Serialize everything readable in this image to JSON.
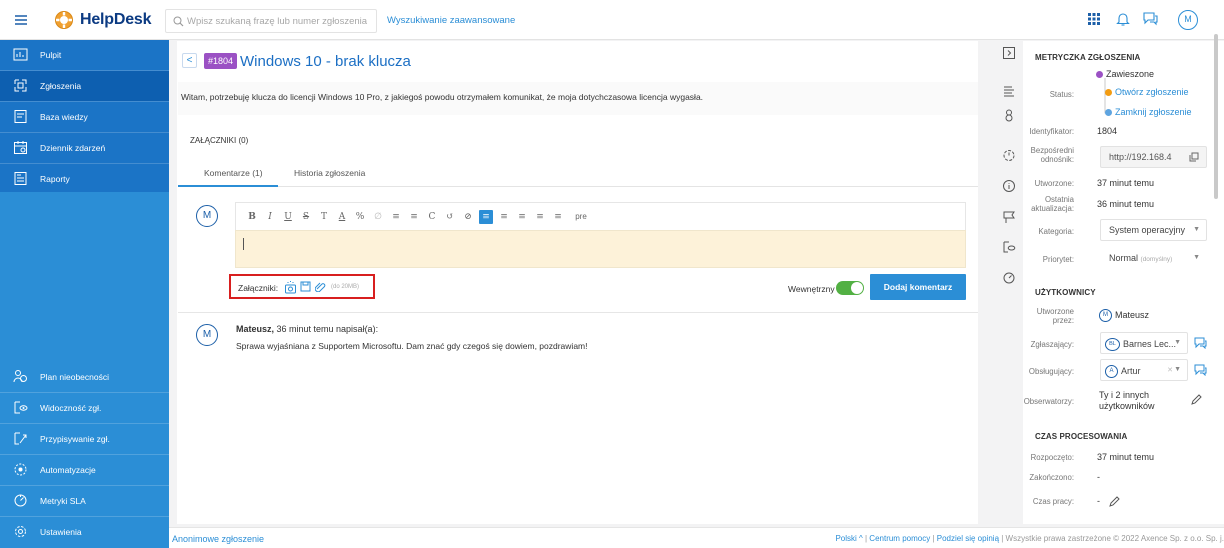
{
  "topbar": {
    "logo": "HelpDesk",
    "search_placeholder": "Wpisz szukaną frazę lub numer zgłoszenia",
    "advanced_search": "Wyszukiwanie zaawansowane",
    "user_initial": "M"
  },
  "sidebar": {
    "items_top": [
      {
        "label": "Pulpit",
        "icon": "dashboard-icon"
      },
      {
        "label": "Zgłoszenia",
        "icon": "tickets-icon",
        "active": true
      },
      {
        "label": "Baza wiedzy",
        "icon": "book-icon"
      },
      {
        "label": "Dziennik zdarzeń",
        "icon": "calendar-icon"
      },
      {
        "label": "Raporty",
        "icon": "report-icon"
      }
    ],
    "items_bottom": [
      {
        "label": "Plan nieobecności",
        "icon": "people-icon"
      },
      {
        "label": "Widoczność zgł.",
        "icon": "visibility-icon"
      },
      {
        "label": "Przypisywanie zgł.",
        "icon": "assign-icon"
      },
      {
        "label": "Automatyzacje",
        "icon": "automation-icon"
      },
      {
        "label": "Metryki SLA",
        "icon": "sla-icon"
      },
      {
        "label": "Ustawienia",
        "icon": "gear-icon"
      }
    ]
  },
  "ticket": {
    "back": "<",
    "id_badge": "#1804",
    "title": "Windows 10 - brak klucza",
    "description": "Witam, potrzebuję klucza do licencji Windows 10 Pro, z jakiegoś powodu otrzymałem komunikat, że moja dotychczasowa licencja wygasła.",
    "attachments_heading": "ZAŁĄCZNIKI (0)",
    "tabs": [
      "Komentarze (1)",
      "Historia zgłoszenia"
    ]
  },
  "editor": {
    "avatar": "M",
    "toolbar": [
      "B",
      "I",
      "U",
      "S",
      "T",
      "A",
      "%",
      "∅",
      "≡",
      "≡",
      "C",
      "↺",
      "⊘",
      "≡",
      "≡",
      "≡",
      "≡",
      "≡",
      "pre"
    ],
    "attachments_label": "Załączniki:",
    "attachments_limit": "(do 20MB)",
    "internal_label": "Wewnętrzny",
    "internal_on": true,
    "submit": "Dodaj komentarz"
  },
  "comment": {
    "avatar": "M",
    "author": "Mateusz,",
    "meta": " 36 minut temu napisał(a):",
    "body": "Sprawa wyjaśniana z Supportem Microsoftu. Dam znać gdy czegoś się dowiem, pozdrawiam!"
  },
  "metrics": {
    "heading": "METRYCZKA ZGŁOSZENIA",
    "status_label": "Status:",
    "status_current": "Zawieszone",
    "status_open": "Otwórz zgłoszenie",
    "status_close": "Zamknij zgłoszenie",
    "id_label": "Identyfikator:",
    "id_value": "1804",
    "link_label": "Bezpośredni odnośnik:",
    "link_value": "http://192.168.4",
    "created_label": "Utworzone:",
    "created_value": "37 minut temu",
    "updated_label": "Ostatnia aktualizacja:",
    "updated_value": "36 minut temu",
    "category_label": "Kategoria:",
    "category_value": "System operacyjny",
    "priority_label": "Priorytet:",
    "priority_value": "Normal",
    "priority_note": "(domyślny)",
    "status_colors": {
      "current": "#9b51c4",
      "open": "#f39c12",
      "close": "#5ea4e0"
    }
  },
  "users": {
    "heading": "UŻYTKOWNICY",
    "created_by_label": "Utworzone przez:",
    "created_by": "Mateusz",
    "created_by_initial": "M",
    "reporter_label": "Zgłaszający:",
    "reporter": "Barnes Lec...",
    "reporter_initials": "BL",
    "handler_label": "Obsługujący:",
    "handler": "Artur",
    "handler_initial": "A",
    "observers_label": "Obserwatorzy:",
    "observers": "Ty i 2 innych użytkowników"
  },
  "processing": {
    "heading": "CZAS PROCESOWANIA",
    "started_label": "Rozpoczęto:",
    "started": "37 minut temu",
    "ended_label": "Zakończono:",
    "ended": "-",
    "worktime_label": "Czas pracy:",
    "worktime": "-"
  },
  "footer": {
    "anon": "Anonimowe zgłoszenie",
    "lang": "Polski ^",
    "help": "Centrum pomocy",
    "share": "Podziel się opinią",
    "copyright": "Wszystkie prawa zastrzeżone © 2022 Axence Sp. z o.o. Sp. j."
  }
}
